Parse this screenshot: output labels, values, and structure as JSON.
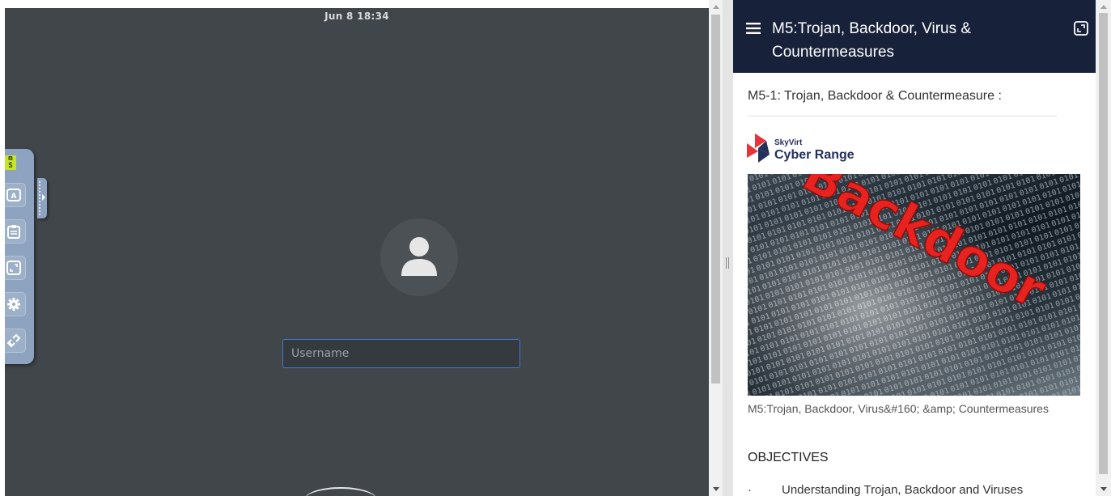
{
  "vm": {
    "clock": "Jun 8  18:34",
    "username_placeholder": "Username"
  },
  "toolbar": {
    "logo_text": "m\nS",
    "buttons": [
      "keyboard-icon",
      "clipboard-icon",
      "fullscreen-icon",
      "gear-icon",
      "disconnect-icon"
    ]
  },
  "panel": {
    "title": "M5:Trojan, Backdoor, Virus & Countermeasures",
    "section_heading": "M5-1: Trojan, Backdoor & Countermeasure  :",
    "brand_small": "SkyVirt",
    "brand_big": "Cyber Range",
    "hero_word": "Backdoor",
    "caption": "M5:Trojan, Backdoor, Virus&#160; &amp; Countermeasures",
    "objectives_heading": "OBJECTIVES",
    "objective_bullet": "·",
    "objective_1": "Understanding Trojan, Backdoor and Viruses"
  },
  "colors": {
    "vm_bg": "#41464b",
    "header_bg": "#18213a",
    "input_border": "#3f7ad1",
    "toolbar_bg": "#8ea3c0",
    "hero_text": "#e8231f"
  }
}
